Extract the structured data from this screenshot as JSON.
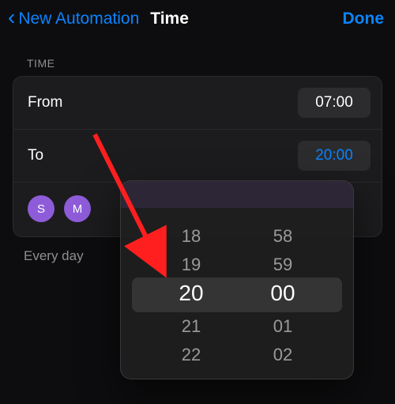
{
  "accent_color": "#0a84ff",
  "nav": {
    "back_label": "New Automation",
    "title": "Time",
    "done_label": "Done"
  },
  "section": {
    "header": "TIME"
  },
  "from": {
    "label": "From",
    "value": "07:00"
  },
  "to": {
    "label": "To",
    "value": "20:00"
  },
  "days": {
    "visible": [
      "S",
      "M"
    ]
  },
  "frequency": "Every day",
  "picker": {
    "hours": [
      "18",
      "19",
      "20",
      "21",
      "22"
    ],
    "minutes": [
      "58",
      "59",
      "00",
      "01",
      "02"
    ],
    "selected_hour": "20",
    "selected_minute": "00"
  }
}
